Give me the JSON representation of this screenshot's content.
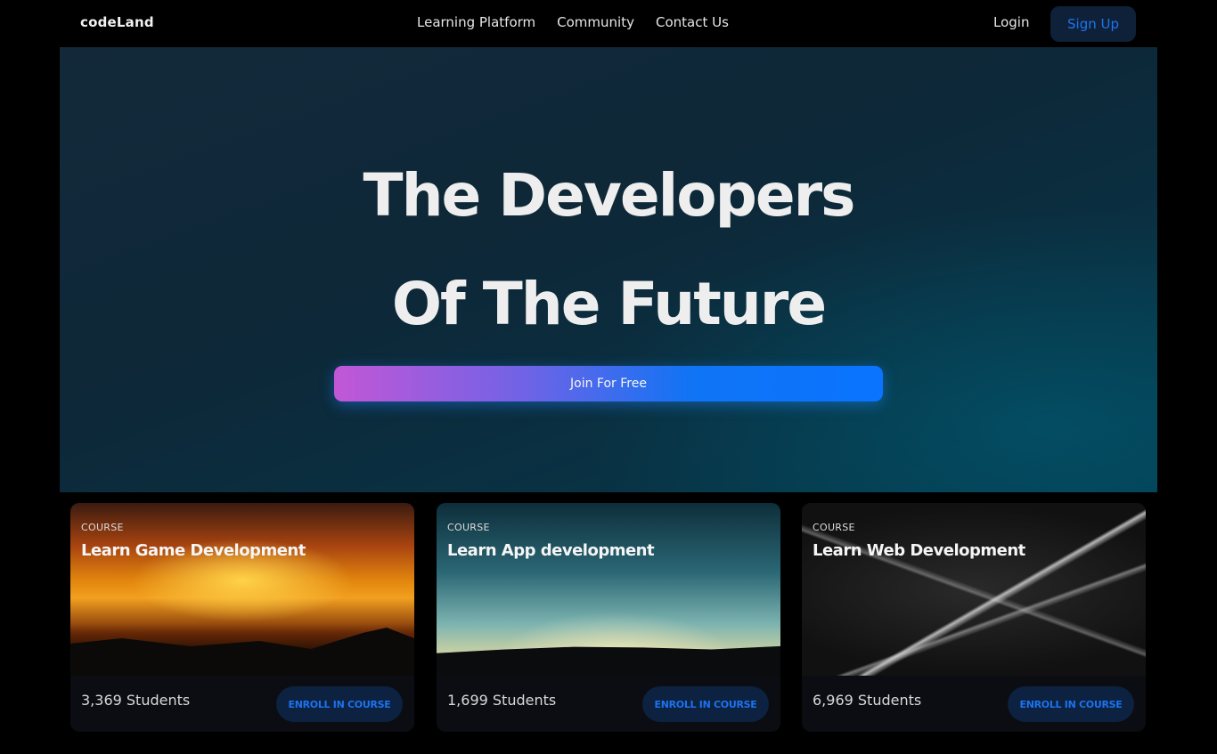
{
  "nav": {
    "brand": "codeLand",
    "links": [
      "Learning Platform",
      "Community",
      "Contact Us"
    ],
    "login": "Login",
    "signup": "Sign Up"
  },
  "hero": {
    "title_line1": "The Developers",
    "title_line2": "Of The Future",
    "cta": "Join For Free"
  },
  "courses": [
    {
      "kicker": "COURSE",
      "title": "Learn Game Development",
      "students": "3,369 Students",
      "button": "ENROLL IN COURSE",
      "image": "orange-sunset"
    },
    {
      "kicker": "COURSE",
      "title": "Learn App development",
      "students": "1,699 Students",
      "button": "ENROLL IN COURSE",
      "image": "blue-dawn-horizon"
    },
    {
      "kicker": "COURSE",
      "title": "Learn Web Development",
      "students": "6,969 Students",
      "button": "ENROLL IN COURSE",
      "image": "gray-light-streaks"
    }
  ],
  "colors": {
    "accent": "#1d72ef",
    "button_bg": "#0c2240",
    "cta_gradient_start": "#c257d6",
    "cta_gradient_end": "#0a74ff"
  }
}
